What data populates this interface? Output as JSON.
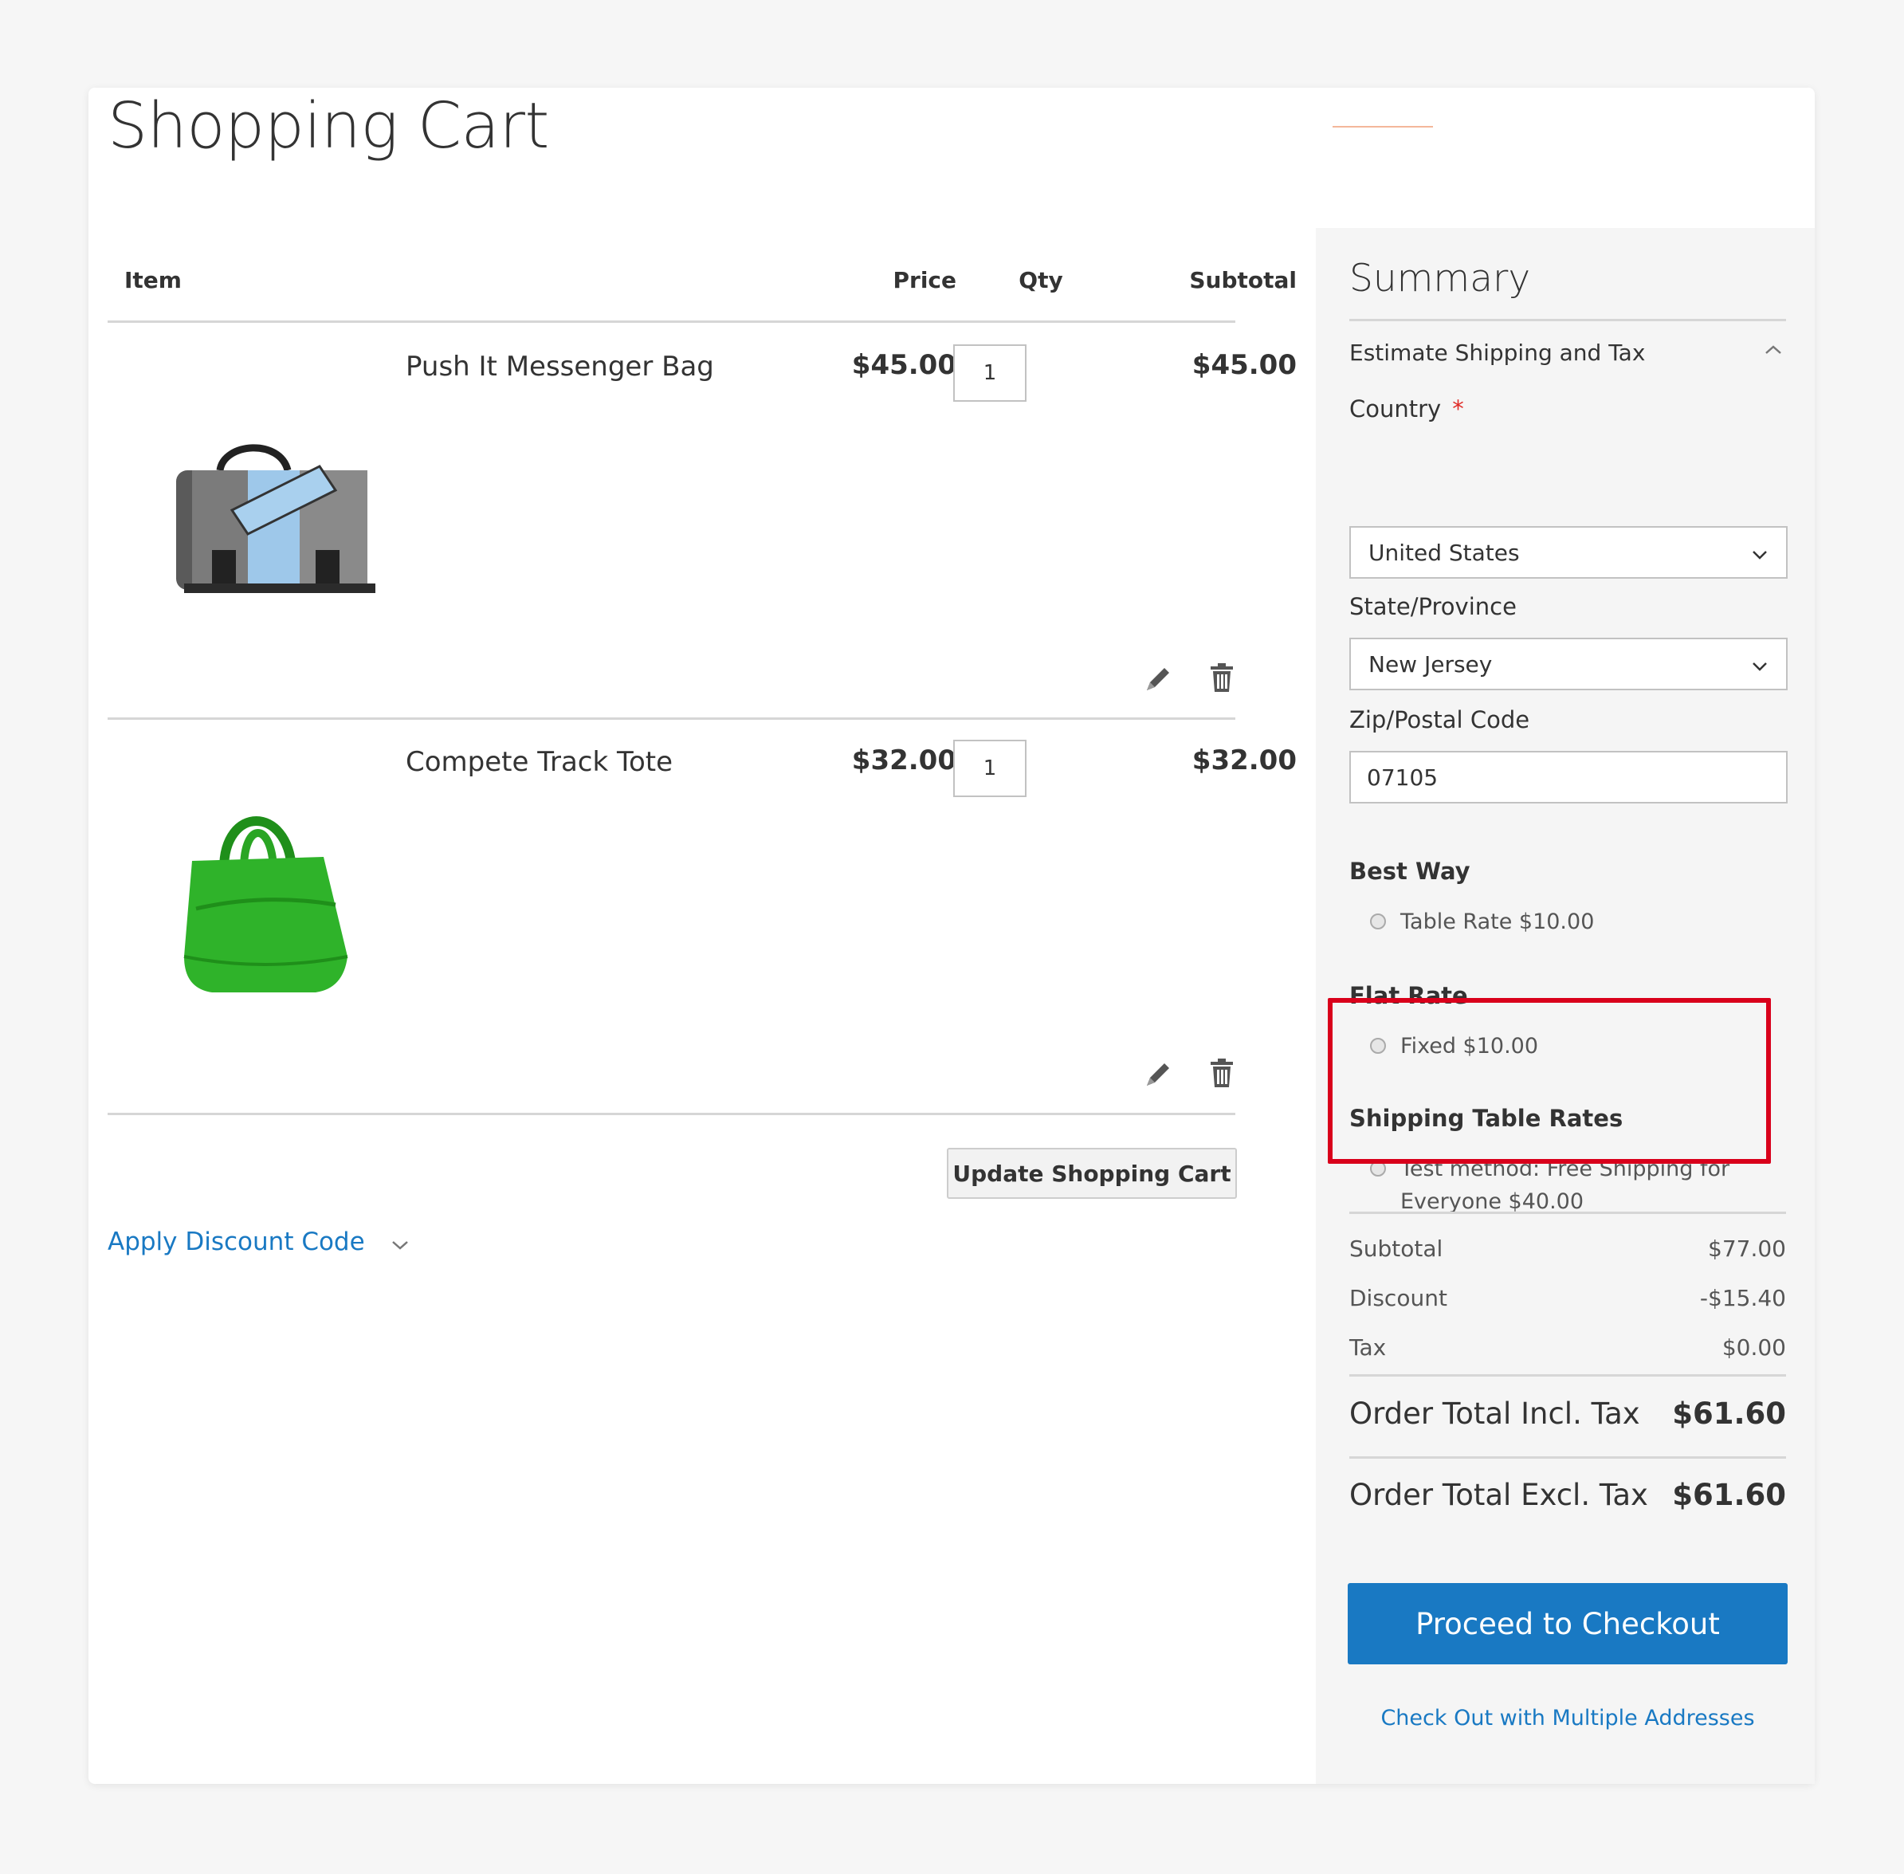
{
  "page_title": "Shopping Cart",
  "cart": {
    "headers": {
      "item": "Item",
      "price": "Price",
      "qty": "Qty",
      "subtotal": "Subtotal"
    },
    "items": [
      {
        "name": "Push It Messenger Bag",
        "price": "$45.00",
        "qty": "1",
        "subtotal": "$45.00",
        "image_icon": "messenger-bag-image"
      },
      {
        "name": "Compete Track Tote",
        "price": "$32.00",
        "qty": "1",
        "subtotal": "$32.00",
        "image_icon": "green-tote-bag-image"
      }
    ],
    "update_button": "Update Shopping Cart",
    "discount_link": "Apply Discount Code"
  },
  "summary": {
    "title": "Summary",
    "estimate_title": "Estimate Shipping and Tax",
    "country_label": "Country",
    "required_mark": "*",
    "country_value": "United States",
    "state_label": "State/Province",
    "state_value": "New Jersey",
    "zip_label": "Zip/Postal Code",
    "zip_value": "07105",
    "carriers": [
      {
        "title": "Best Way",
        "rate": "Table Rate $10.00"
      },
      {
        "title": "Flat Rate",
        "rate": "Fixed $10.00"
      },
      {
        "title": "Shipping Table Rates",
        "rate_line1": "Test method: Free Shipping for",
        "rate_line2": "Everyone $40.00"
      }
    ],
    "totals": [
      {
        "label": "Subtotal",
        "value": "$77.00"
      },
      {
        "label": "Discount",
        "value": "-$15.40"
      },
      {
        "label": "Tax",
        "value": "$0.00"
      }
    ],
    "grand_incl": {
      "label": "Order Total Incl. Tax",
      "value": "$61.60"
    },
    "grand_excl": {
      "label": "Order Total Excl. Tax",
      "value": "$61.60"
    },
    "checkout_button": "Proceed to Checkout",
    "multi_address_link": "Check Out with Multiple Addresses"
  },
  "colors": {
    "accent_blue": "#1979c3",
    "highlight_red": "#d9001b",
    "required_red": "#e02b27",
    "summary_bg": "#f5f5f5"
  }
}
